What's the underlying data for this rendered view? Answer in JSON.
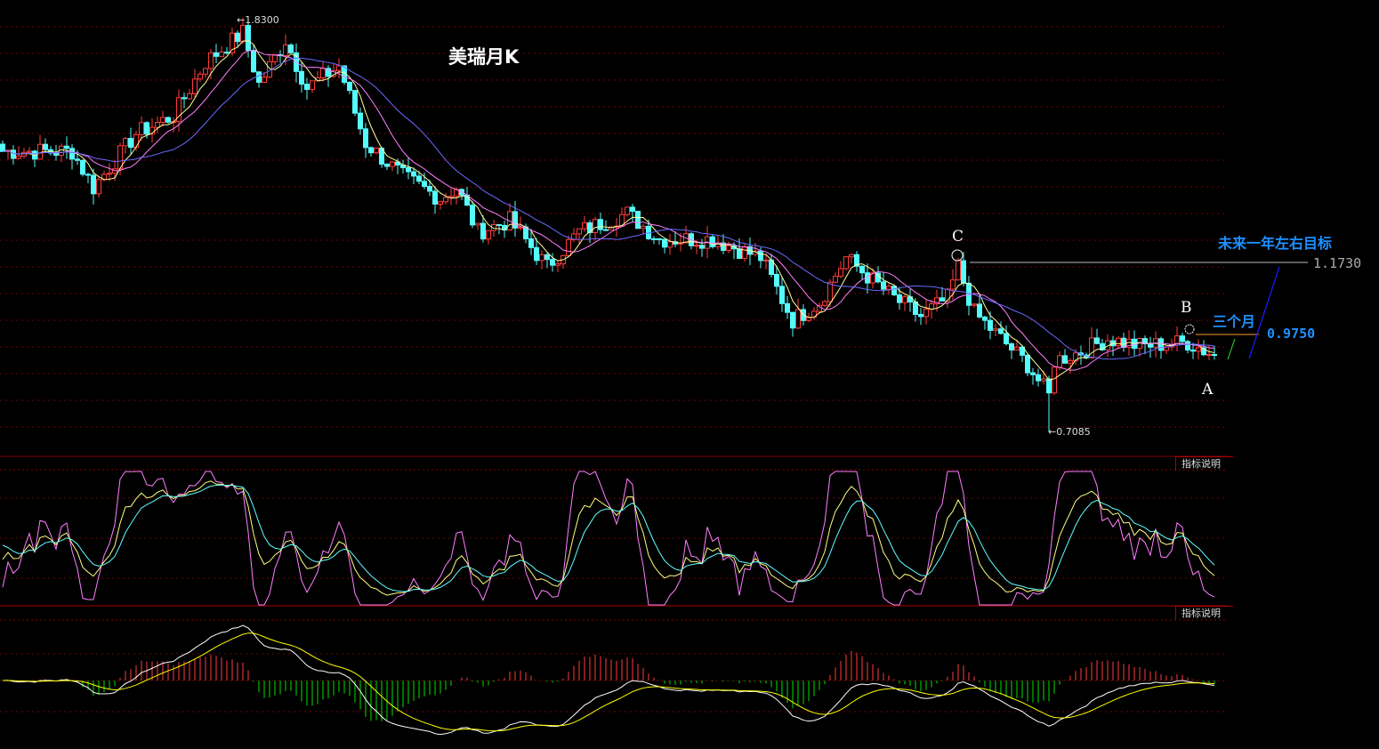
{
  "chart_data": {
    "type": "candlestick",
    "title": "美瑞月K",
    "period": "monthly",
    "ylim": [
      0.7085,
      1.83
    ],
    "close_anchors": [
      [
        0,
        1.468
      ],
      [
        13,
        1.468
      ],
      [
        17,
        1.37
      ],
      [
        25,
        1.516
      ],
      [
        32,
        1.565
      ],
      [
        38,
        1.71
      ],
      [
        45,
        1.79
      ],
      [
        48,
        1.65
      ],
      [
        53,
        1.77
      ],
      [
        57,
        1.64
      ],
      [
        63,
        1.7
      ],
      [
        68,
        1.49
      ],
      [
        75,
        1.4
      ],
      [
        82,
        1.34
      ],
      [
        85,
        1.37
      ],
      [
        89,
        1.25
      ],
      [
        95,
        1.28
      ],
      [
        102,
        1.155
      ],
      [
        108,
        1.25
      ],
      [
        117,
        1.3
      ],
      [
        123,
        1.23
      ],
      [
        133,
        1.23
      ],
      [
        142,
        1.18
      ],
      [
        148,
        1.01
      ],
      [
        153,
        1.06
      ],
      [
        158,
        1.18
      ],
      [
        162,
        1.13
      ],
      [
        167,
        1.07
      ],
      [
        172,
        1.02
      ],
      [
        177,
        1.07
      ],
      [
        179,
        1.155
      ],
      [
        182,
        1.03
      ],
      [
        187,
        0.96
      ],
      [
        192,
        0.89
      ],
      [
        196,
        0.805
      ],
      [
        197,
        0.9
      ],
      [
        202,
        0.925
      ],
      [
        207,
        0.96
      ],
      [
        213,
        0.94
      ],
      [
        222,
        0.95
      ],
      [
        227,
        0.915
      ]
    ],
    "extremes": {
      "high": {
        "index": 45,
        "label": "1.8300",
        "value": 1.83
      },
      "low": {
        "index": 196,
        "label": "0.7085",
        "value": 0.7085
      }
    },
    "moving_averages": [
      5,
      10,
      20
    ],
    "indicators": [
      "KDJ",
      "MACD"
    ],
    "annotations": {
      "C": "C",
      "B": "B",
      "A": "A",
      "target_year_label": "未来一年左右目标",
      "target_year_value": "1.1730",
      "target_3m_label": "三个月",
      "target_3m_value": "0.9750"
    },
    "colors": {
      "up": "#ff3c3c",
      "down": "#54fcfc",
      "ma5": "#ffff9a",
      "ma10": "#ff80ff",
      "ma20": "#6a6aff",
      "accent": "#1e90ff"
    }
  },
  "panels": {
    "indicator_help_1": "指标说明",
    "indicator_help_2": "指标说明"
  }
}
